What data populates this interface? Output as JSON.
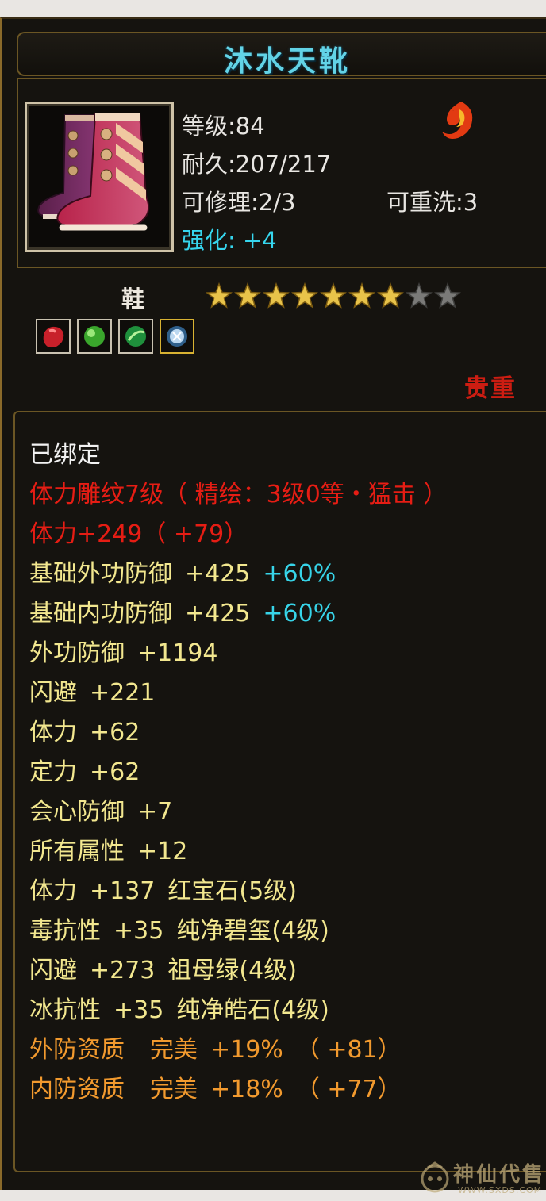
{
  "item": {
    "name": "沐水天靴",
    "level_text": "等级:84",
    "durability_text": "耐久:207/217",
    "repairable_text": "可修理:2/3",
    "rewashable_text": "可重洗:3",
    "enhance_label": "强化:",
    "enhance_value": "+4",
    "type": "鞋",
    "star_rating": 7,
    "star_max": 9,
    "quality": "贵重",
    "brand_icon": "flame-emblem-icon",
    "item_icon": "boots-icon",
    "gem_slots": [
      {
        "name": "red-gem-icon",
        "color": "#c8202a"
      },
      {
        "name": "green-gem-icon",
        "color": "#4cc23a"
      },
      {
        "name": "green-gem-icon",
        "color": "#2fae4a"
      },
      {
        "name": "white-gem-icon",
        "color": "#bcd8f0"
      }
    ]
  },
  "attributes": {
    "bound": "已绑定",
    "engrave": "体力雕纹7级（ 精绘：3级0等・猛击 ）",
    "engrave_stat": "体力+249（ +79）",
    "base_ext_def": {
      "label": "基础外功防御",
      "value": "+425",
      "pct": "+60%"
    },
    "base_int_def": {
      "label": "基础内功防御",
      "value": "+425",
      "pct": "+60%"
    },
    "ext_def": {
      "label": "外功防御",
      "value": "+1194"
    },
    "dodge": {
      "label": "闪避",
      "value": "+221"
    },
    "stamina": {
      "label": "体力",
      "value": "+62"
    },
    "focus": {
      "label": "定力",
      "value": "+62"
    },
    "crit_def": {
      "label": "会心防御",
      "value": "+7"
    },
    "all_attr": {
      "label": "所有属性",
      "value": "+12"
    },
    "gem1": {
      "label": "体力",
      "value": "+137",
      "gem": "红宝石",
      "level": "(5级)"
    },
    "gem2": {
      "label": "毒抗性",
      "value": "+35",
      "gem": "纯净碧玺",
      "level": "(4级)"
    },
    "gem3": {
      "label": "闪避",
      "value": "+273",
      "gem": "祖母绿",
      "level": "(4级)"
    },
    "gem4": {
      "label": "冰抗性",
      "value": "+35",
      "gem": "纯净皓石",
      "level": "(4级)"
    },
    "apt_ext": {
      "label": "外防资质",
      "grade": "完美",
      "pct": "+19%",
      "bonus": "（ +81）"
    },
    "apt_int": {
      "label": "内防资质",
      "grade": "完美",
      "pct": "+18%",
      "bonus": "（ +77）"
    }
  },
  "watermark": {
    "title": "神仙代售",
    "url": "WWW.SXDS.COM",
    "icon": "mascot-logo-icon"
  },
  "colors": {
    "title": "#62d3e6",
    "bound": "#f2f2f2",
    "engrave": "#e61d14",
    "base_stat": "#f2e78f",
    "percent": "#37d4e8",
    "aptitude": "#f29a2e",
    "quality": "#cc1d12",
    "frame": "#6b5624"
  }
}
